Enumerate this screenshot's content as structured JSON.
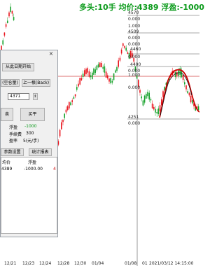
{
  "status_line": "多头:10手 均价:4389 浮盈:-1000",
  "price_labels": {
    "p4570": "4570",
    "p4509": "4509",
    "p4460": "4460",
    "p4400": "4400",
    "p4389": "4389",
    "p4251": "4251",
    "zero1": "0.000",
    "zero2": "0.000",
    "zero3": "0.000",
    "zero4": "0.000",
    "zero5": "0.000",
    "zero6": "0.000",
    "zero7": "0.000",
    "t1": "1.000",
    "t2": "1.000",
    "timestamp": "2021/03/12 14:15:00"
  },
  "x_axis": [
    "12/21",
    "12/23",
    "12/24",
    "12/28",
    "12/30",
    "01/04",
    "01/08",
    "01"
  ],
  "dialog": {
    "close": "×",
    "from_date_btn": "从此日期开始",
    "fill_btn": "(空仓量)",
    "prev_btn": "上一根(Back)",
    "price_value": "4371",
    "sell_btn": "卖",
    "buy_btn": "买平",
    "float_label": "浮盈",
    "float_value": "-1000",
    "fee_label": "手续费",
    "fee_value": "300",
    "rate_label": "盈率",
    "rate_value": "5(元/手)",
    "tab_params": "参数设置",
    "tab_stats": "统计报表",
    "col_avg": "均价",
    "col_float": "浮盈",
    "row_avg": "4389",
    "row_float": "-1000.00",
    "row_flag": "4"
  },
  "colors": {
    "up": "#e8141c",
    "down": "#17a22b",
    "status": "#0a9a1a",
    "line": "#cc0000"
  }
}
